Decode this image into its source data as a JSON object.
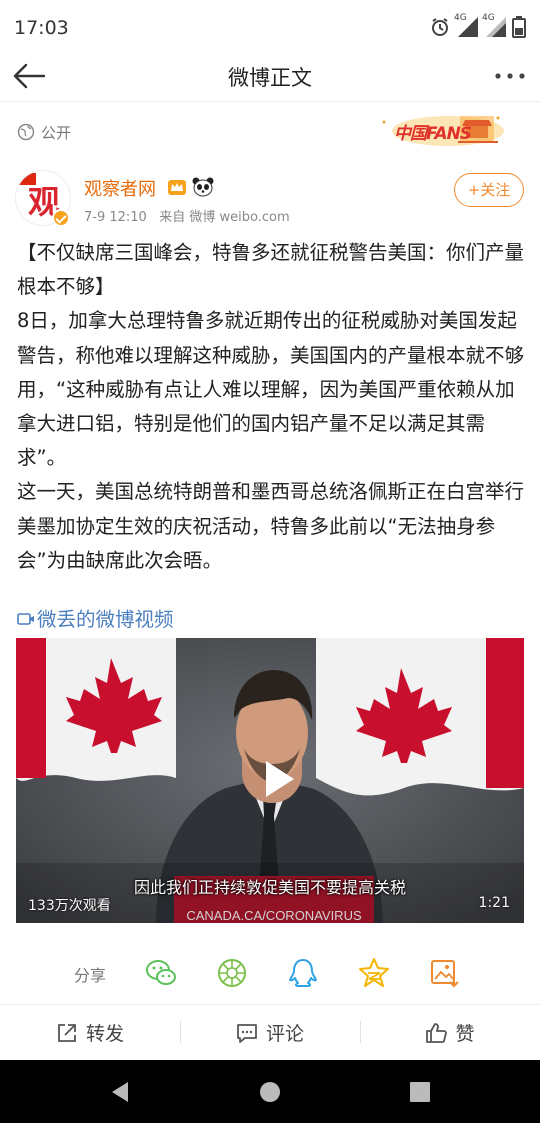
{
  "status_bar": {
    "time": "17:03",
    "network_1": "4G",
    "network_2": "4G"
  },
  "nav": {
    "title": "微博正文",
    "back_icon": "arrow-left-icon",
    "more_icon": "more-dots-icon"
  },
  "post": {
    "visibility": "公开",
    "fans_badge": "中国FANS",
    "author": {
      "name": "观察者网",
      "avatar_char": "观"
    },
    "time": "7-9 12:10",
    "source": "来自 微博 weibo.com",
    "follow_label": "+关注",
    "paragraphs": [
      "【不仅缺席三国峰会，特鲁多还就征税警告美国：你们产量根本不够】",
      "8日，加拿大总理特鲁多就近期传出的征税威胁对美国发起警告，称他难以理解这种威胁，美国国内的产量根本就不够用，“这种威胁有点让人难以理解，因为美国严重依赖从加拿大进口铝，特别是他们的国内铝产量不足以满足其需求”。",
      "这一天，美国总统特朗普和墨西哥总统洛佩斯正在白宫举行美墨加协定生效的庆祝活动，特鲁多此前以“无法抽身参会”为由缺席此次会晤。"
    ],
    "video_link": "微丢的微博视频",
    "video": {
      "caption": "因此我们正持续敦促美国不要提高关税",
      "views": "133万次观看",
      "duration": "1:21",
      "podium_text": "CANADA.CA/CORONAVIRUS"
    }
  },
  "share": {
    "label": "分享",
    "targets": [
      "wechat-icon",
      "moments-icon",
      "qq-icon",
      "qzone-icon",
      "save-image-icon"
    ]
  },
  "actions": {
    "repost": "转发",
    "comment": "评论",
    "like": "赞"
  },
  "colors": {
    "accent_orange": "#f28a2e",
    "link_blue": "#4b7fbf",
    "name_orange": "#e86b0c"
  }
}
